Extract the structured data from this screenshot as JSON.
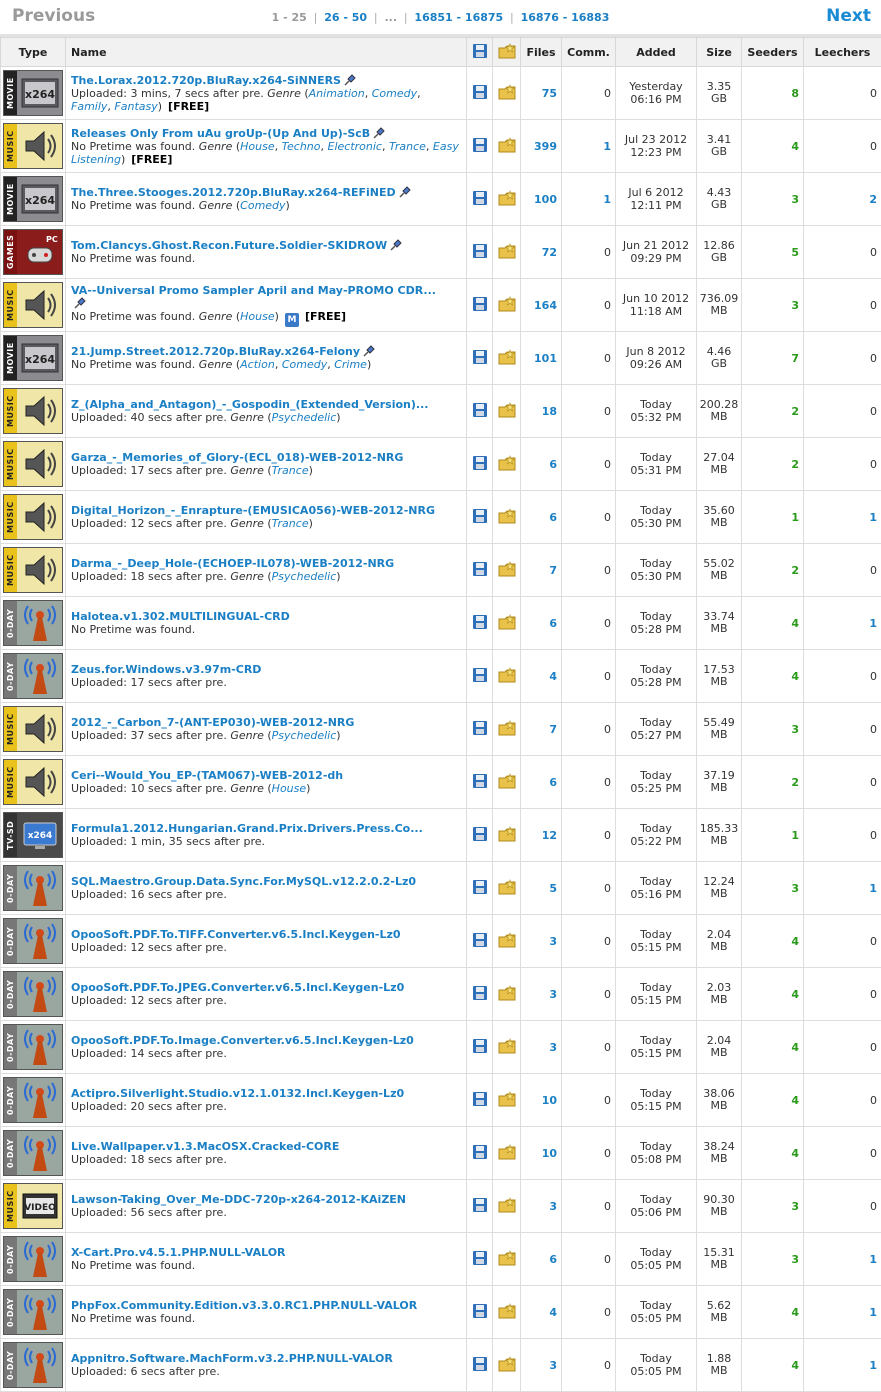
{
  "pager": {
    "prev_label": "Previous",
    "next_label": "Next",
    "current": "1 - 25",
    "links": [
      "26 - 50",
      "16851 - 16875",
      "16876 - 16883"
    ],
    "ellipsis": "..."
  },
  "columns": {
    "type": "Type",
    "name": "Name",
    "files": "Files",
    "comm": "Comm.",
    "added": "Added",
    "size": "Size",
    "seeders": "Seeders",
    "leechers": "Leechers"
  },
  "colors": {
    "link": "#1a7fc4",
    "seeders": "#2a9a1a",
    "music": "#e9c31c"
  },
  "rows": [
    {
      "cat": "movie",
      "cat_label": "MOVIE",
      "icon": "x264-icon",
      "name": "The.Lorax.2012.720p.BluRay.x264-SiNNERS",
      "pin": true,
      "sub": "Uploaded: 3 mins, 7 secs after pre.",
      "genres": [
        "Animation",
        "Comedy",
        "Family",
        "Fantasy"
      ],
      "free": "[FREE]",
      "files": "75",
      "comm": "0",
      "added1": "Yesterday",
      "added2": "06:16 PM",
      "size1": "3.35",
      "size2": "GB",
      "seeders": "8",
      "leechers": "0"
    },
    {
      "cat": "music",
      "cat_label": "MUSIC",
      "icon": "speaker-icon",
      "name": "Releases Only From uAu groUp-(Up And Up)-ScB",
      "pin": true,
      "sub": "No Pretime was found.",
      "genres": [
        "House",
        "Techno",
        "Electronic",
        "Trance",
        "Easy Listening"
      ],
      "free": "[FREE]",
      "files": "399",
      "comm": "1",
      "added1": "Jul 23 2012",
      "added2": "12:23 PM",
      "size1": "3.41",
      "size2": "GB",
      "seeders": "4",
      "leechers": "0"
    },
    {
      "cat": "movie",
      "cat_label": "MOVIE",
      "icon": "x264-icon",
      "name": "The.Three.Stooges.2012.720p.BluRay.x264-REFiNED",
      "pin": true,
      "sub": "No Pretime was found.",
      "genres": [
        "Comedy"
      ],
      "free": "",
      "files": "100",
      "comm": "1",
      "added1": "Jul 6 2012",
      "added2": "12:11 PM",
      "size1": "4.43",
      "size2": "GB",
      "seeders": "3",
      "leechers": "2"
    },
    {
      "cat": "games",
      "cat_label": "GAMES",
      "icon": "pc-game-icon",
      "name": "Tom.Clancys.Ghost.Recon.Future.Soldier-SKIDROW",
      "pin": true,
      "sub": "No Pretime was found.",
      "genres": [],
      "free": "",
      "files": "72",
      "comm": "0",
      "added1": "Jun 21 2012",
      "added2": "09:29 PM",
      "size1": "12.86",
      "size2": "GB",
      "seeders": "5",
      "leechers": "0"
    },
    {
      "cat": "music",
      "cat_label": "MUSIC",
      "icon": "speaker-icon",
      "name": "VA--Universal Promo Sampler April and May-PROMO CDR...",
      "pin": true,
      "pin_newline": true,
      "sub": "No Pretime was found.",
      "genres": [
        "House"
      ],
      "mark": true,
      "free": "[FREE]",
      "files": "164",
      "comm": "0",
      "added1": "Jun 10 2012",
      "added2": "11:18 AM",
      "size1": "736.09",
      "size2": "MB",
      "seeders": "3",
      "leechers": "0"
    },
    {
      "cat": "movie",
      "cat_label": "MOVIE",
      "icon": "x264-icon",
      "name": "21.Jump.Street.2012.720p.BluRay.x264-Felony",
      "pin": true,
      "sub": "No Pretime was found.",
      "genres": [
        "Action",
        "Comedy",
        "Crime"
      ],
      "free": "",
      "files": "101",
      "comm": "0",
      "added1": "Jun 8 2012",
      "added2": "09:26 AM",
      "size1": "4.46",
      "size2": "GB",
      "seeders": "7",
      "leechers": "0"
    },
    {
      "cat": "music",
      "cat_label": "MUSIC",
      "icon": "speaker-icon",
      "name": "Z_(Alpha_and_Antagon)_-_Gospodin_(Extended_Version)...",
      "pin": false,
      "sub": "Uploaded: 40 secs after pre.",
      "genres": [
        "Psychedelic"
      ],
      "free": "",
      "files": "18",
      "comm": "0",
      "added1": "Today",
      "added2": "05:32 PM",
      "size1": "200.28",
      "size2": "MB",
      "seeders": "2",
      "leechers": "0"
    },
    {
      "cat": "music",
      "cat_label": "MUSIC",
      "icon": "speaker-icon",
      "name": "Garza_-_Memories_of_Glory-(ECL_018)-WEB-2012-NRG",
      "pin": false,
      "sub": "Uploaded: 17 secs after pre.",
      "genres": [
        "Trance"
      ],
      "free": "",
      "files": "6",
      "comm": "0",
      "added1": "Today",
      "added2": "05:31 PM",
      "size1": "27.04",
      "size2": "MB",
      "seeders": "2",
      "leechers": "0"
    },
    {
      "cat": "music",
      "cat_label": "MUSIC",
      "icon": "speaker-icon",
      "name": "Digital_Horizon_-_Enrapture-(EMUSICA056)-WEB-2012-NRG",
      "pin": false,
      "sub": "Uploaded: 12 secs after pre.",
      "genres": [
        "Trance"
      ],
      "free": "",
      "files": "6",
      "comm": "0",
      "added1": "Today",
      "added2": "05:30 PM",
      "size1": "35.60",
      "size2": "MB",
      "seeders": "1",
      "leechers": "1"
    },
    {
      "cat": "music",
      "cat_label": "MUSIC",
      "icon": "speaker-icon",
      "name": "Darma_-_Deep_Hole-(ECHOEP-IL078)-WEB-2012-NRG",
      "pin": false,
      "sub": "Uploaded: 18 secs after pre.",
      "genres": [
        "Psychedelic"
      ],
      "free": "",
      "files": "7",
      "comm": "0",
      "added1": "Today",
      "added2": "05:30 PM",
      "size1": "55.02",
      "size2": "MB",
      "seeders": "2",
      "leechers": "0"
    },
    {
      "cat": "oday",
      "cat_label": "0-DAY",
      "icon": "antenna-icon",
      "name": "Halotea.v1.302.MULTILINGUAL-CRD",
      "pin": false,
      "sub": "No Pretime was found.",
      "genres": [],
      "free": "",
      "files": "6",
      "comm": "0",
      "added1": "Today",
      "added2": "05:28 PM",
      "size1": "33.74",
      "size2": "MB",
      "seeders": "4",
      "leechers": "1"
    },
    {
      "cat": "oday",
      "cat_label": "0-DAY",
      "icon": "antenna-icon",
      "name": "Zeus.for.Windows.v3.97m-CRD",
      "pin": false,
      "sub": "Uploaded: 17 secs after pre.",
      "genres": [],
      "free": "",
      "files": "4",
      "comm": "0",
      "added1": "Today",
      "added2": "05:28 PM",
      "size1": "17.53",
      "size2": "MB",
      "seeders": "4",
      "leechers": "0"
    },
    {
      "cat": "music",
      "cat_label": "MUSIC",
      "icon": "speaker-icon",
      "name": "2012_-_Carbon_7-(ANT-EP030)-WEB-2012-NRG",
      "pin": false,
      "sub": "Uploaded: 37 secs after pre.",
      "genres": [
        "Psychedelic"
      ],
      "free": "",
      "files": "7",
      "comm": "0",
      "added1": "Today",
      "added2": "05:27 PM",
      "size1": "55.49",
      "size2": "MB",
      "seeders": "3",
      "leechers": "0"
    },
    {
      "cat": "music",
      "cat_label": "MUSIC",
      "icon": "speaker-icon",
      "name": "Ceri--Would_You_EP-(TAM067)-WEB-2012-dh",
      "pin": false,
      "sub": "Uploaded: 10 secs after pre.",
      "genres": [
        "House"
      ],
      "free": "",
      "files": "6",
      "comm": "0",
      "added1": "Today",
      "added2": "05:25 PM",
      "size1": "37.19",
      "size2": "MB",
      "seeders": "2",
      "leechers": "0"
    },
    {
      "cat": "tv",
      "cat_label": "TV-SD",
      "icon": "tv-x264-icon",
      "name": "Formula1.2012.Hungarian.Grand.Prix.Drivers.Press.Co...",
      "pin": false,
      "sub": "Uploaded: 1 min, 35 secs after pre.",
      "genres": [],
      "free": "",
      "files": "12",
      "comm": "0",
      "added1": "Today",
      "added2": "05:22 PM",
      "size1": "185.33",
      "size2": "MB",
      "seeders": "1",
      "leechers": "0"
    },
    {
      "cat": "oday",
      "cat_label": "0-DAY",
      "icon": "antenna-icon",
      "name": "SQL.Maestro.Group.Data.Sync.For.MySQL.v12.2.0.2-Lz0",
      "pin": false,
      "sub": "Uploaded: 16 secs after pre.",
      "genres": [],
      "free": "",
      "files": "5",
      "comm": "0",
      "added1": "Today",
      "added2": "05:16 PM",
      "size1": "12.24",
      "size2": "MB",
      "seeders": "3",
      "leechers": "1"
    },
    {
      "cat": "oday",
      "cat_label": "0-DAY",
      "icon": "antenna-icon",
      "name": "OpooSoft.PDF.To.TIFF.Converter.v6.5.Incl.Keygen-Lz0",
      "pin": false,
      "sub": "Uploaded: 12 secs after pre.",
      "genres": [],
      "free": "",
      "files": "3",
      "comm": "0",
      "added1": "Today",
      "added2": "05:15 PM",
      "size1": "2.04",
      "size2": "MB",
      "seeders": "4",
      "leechers": "0"
    },
    {
      "cat": "oday",
      "cat_label": "0-DAY",
      "icon": "antenna-icon",
      "name": "OpooSoft.PDF.To.JPEG.Converter.v6.5.Incl.Keygen-Lz0",
      "pin": false,
      "sub": "Uploaded: 12 secs after pre.",
      "genres": [],
      "free": "",
      "files": "3",
      "comm": "0",
      "added1": "Today",
      "added2": "05:15 PM",
      "size1": "2.03",
      "size2": "MB",
      "seeders": "4",
      "leechers": "0"
    },
    {
      "cat": "oday",
      "cat_label": "0-DAY",
      "icon": "antenna-icon",
      "name": "OpooSoft.PDF.To.Image.Converter.v6.5.Incl.Keygen-Lz0",
      "pin": false,
      "sub": "Uploaded: 14 secs after pre.",
      "genres": [],
      "free": "",
      "files": "3",
      "comm": "0",
      "added1": "Today",
      "added2": "05:15 PM",
      "size1": "2.04",
      "size2": "MB",
      "seeders": "4",
      "leechers": "0"
    },
    {
      "cat": "oday",
      "cat_label": "0-DAY",
      "icon": "antenna-icon",
      "name": "Actipro.Silverlight.Studio.v12.1.0132.Incl.Keygen-Lz0",
      "pin": false,
      "sub": "Uploaded: 20 secs after pre.",
      "genres": [],
      "free": "",
      "files": "10",
      "comm": "0",
      "added1": "Today",
      "added2": "05:15 PM",
      "size1": "38.06",
      "size2": "MB",
      "seeders": "4",
      "leechers": "0"
    },
    {
      "cat": "oday",
      "cat_label": "0-DAY",
      "icon": "antenna-icon",
      "name": "Live.Wallpaper.v1.3.MacOSX.Cracked-CORE",
      "pin": false,
      "sub": "Uploaded: 18 secs after pre.",
      "genres": [],
      "free": "",
      "files": "10",
      "comm": "0",
      "added1": "Today",
      "added2": "05:08 PM",
      "size1": "38.24",
      "size2": "MB",
      "seeders": "4",
      "leechers": "0"
    },
    {
      "cat": "music",
      "cat_label": "MUSIC",
      "icon": "video-icon",
      "name": "Lawson-Taking_Over_Me-DDC-720p-x264-2012-KAiZEN",
      "pin": false,
      "sub": "Uploaded: 56 secs after pre.",
      "genres": [],
      "free": "",
      "files": "3",
      "comm": "0",
      "added1": "Today",
      "added2": "05:06 PM",
      "size1": "90.30",
      "size2": "MB",
      "seeders": "3",
      "leechers": "0"
    },
    {
      "cat": "oday",
      "cat_label": "0-DAY",
      "icon": "antenna-icon",
      "name": "X-Cart.Pro.v4.5.1.PHP.NULL-VALOR",
      "pin": false,
      "sub": "No Pretime was found.",
      "genres": [],
      "free": "",
      "files": "6",
      "comm": "0",
      "added1": "Today",
      "added2": "05:05 PM",
      "size1": "15.31",
      "size2": "MB",
      "seeders": "3",
      "leechers": "1"
    },
    {
      "cat": "oday",
      "cat_label": "0-DAY",
      "icon": "antenna-icon",
      "name": "PhpFox.Community.Edition.v3.3.0.RC1.PHP.NULL-VALOR",
      "pin": false,
      "sub": "No Pretime was found.",
      "genres": [],
      "free": "",
      "files": "4",
      "comm": "0",
      "added1": "Today",
      "added2": "05:05 PM",
      "size1": "5.62",
      "size2": "MB",
      "seeders": "4",
      "leechers": "1"
    },
    {
      "cat": "oday",
      "cat_label": "0-DAY",
      "icon": "antenna-icon",
      "name": "Appnitro.Software.MachForm.v3.2.PHP.NULL-VALOR",
      "pin": false,
      "sub": "Uploaded: 6 secs after pre.",
      "genres": [],
      "free": "",
      "files": "3",
      "comm": "0",
      "added1": "Today",
      "added2": "05:05 PM",
      "size1": "1.88",
      "size2": "MB",
      "seeders": "4",
      "leechers": "1"
    }
  ]
}
